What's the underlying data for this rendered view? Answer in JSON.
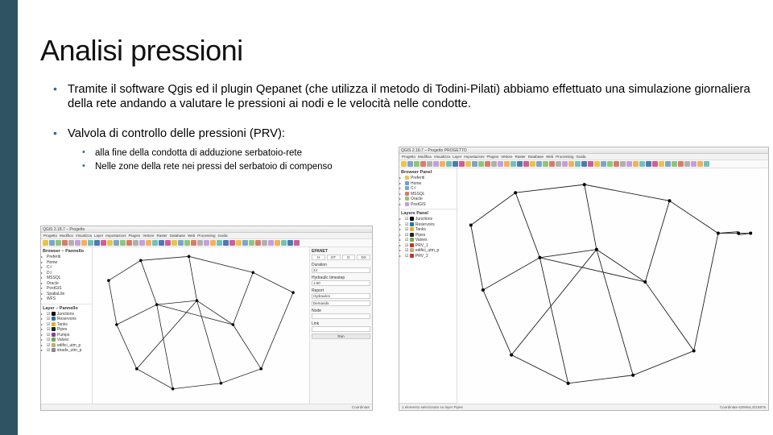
{
  "slide": {
    "title_a": "Analisi",
    "title_b": " pressioni",
    "bullet1": "Tramite il software Qgis ed il plugin Qepanet (che utilizza il metodo di Todini-Pilati) abbiamo effettuato una simulazione giornaliera della rete andando a valutare le pressioni ai nodi e le velocità nelle condotte.",
    "bullet2": "Valvola di controllo delle pressioni (PRV):",
    "sub1": "alla fine della condotta di adduzione serbatoio-rete",
    "sub2": "Nelle zone della rete nei pressi del serbatoio di compenso"
  },
  "shotL": {
    "title": "QGIS 2.18.7 – Progetto",
    "menus": [
      "Progetto",
      "Modifica",
      "Visualizza",
      "Layer",
      "Impostazioni",
      "Plugins",
      "Vettore",
      "Raster",
      "Database",
      "Web",
      "Processing",
      "Guida"
    ],
    "browser_hd": "Browser – Pannello",
    "browser_items": [
      "Preferiti",
      "Home",
      "C:/",
      "D:/",
      "MSSQL",
      "Oracle",
      "PostGIS",
      "SpatiaLite",
      "WFS"
    ],
    "layers_hd": "Layer – Pannello",
    "layers": [
      {
        "name": "Junctions",
        "color": "#000000"
      },
      {
        "name": "Reservoirs",
        "color": "#2b6fb3"
      },
      {
        "name": "Tanks",
        "color": "#e0b030"
      },
      {
        "name": "Pipes",
        "color": "#222222"
      },
      {
        "name": "Pumps",
        "color": "#8b3fa0"
      },
      {
        "name": "Valves",
        "color": "#6fae4c"
      },
      {
        "name": "edifici_utm_p",
        "color": "#c9a87a"
      },
      {
        "name": "strade_utm_p",
        "color": "#888888"
      }
    ],
    "right_hd": "EPANET",
    "tabs": [
      "H",
      "DT",
      "D",
      "DS"
    ],
    "duration_lbl": "Duration",
    "duration_val": "24",
    "hydts_lbl": "Hydraulic timestep",
    "hydts_val": "1:00",
    "report_lbl": "Report",
    "hyd_lbl": "Hydraulics",
    "dem_lbl": "Demands",
    "node_lbl": "Node",
    "link_lbl": "Link",
    "run_lbl": "Run",
    "status": "Coordinate"
  },
  "shotR": {
    "title": "QGIS 2.18.7 – Progetto PROGETTO",
    "menus": [
      "Progetto",
      "Modifica",
      "Visualizza",
      "Layer",
      "Impostazioni",
      "Plugins",
      "Vettore",
      "Raster",
      "Database",
      "Web",
      "Processing",
      "Guida"
    ],
    "browser_hd": "Browser Panel",
    "browser_items": [
      {
        "name": "Preferiti",
        "color": "#e9c34b"
      },
      {
        "name": "Home",
        "color": "#6aa0d8"
      },
      {
        "name": "C:/",
        "color": "#7aa6c9"
      },
      {
        "name": "MSSQL",
        "color": "#d87c6a"
      },
      {
        "name": "Oracle",
        "color": "#8fc57a"
      },
      {
        "name": "PostGIS",
        "color": "#c49fd8"
      }
    ],
    "layers_hd": "Layers Panel",
    "layers": [
      {
        "name": "Junctions",
        "color": "#000000"
      },
      {
        "name": "Reservoirs",
        "color": "#2b6fb3"
      },
      {
        "name": "Tanks",
        "color": "#e0b030"
      },
      {
        "name": "Pipes",
        "color": "#222222"
      },
      {
        "name": "Valves",
        "color": "#6fae4c"
      },
      {
        "name": "PRV_1",
        "color": "#c0342b"
      },
      {
        "name": "edifici_utm_p",
        "color": "#c9a87a"
      },
      {
        "name": "PRV_2",
        "color": "#c0342b"
      }
    ],
    "status_left": "1 elemento selezionato su layer Pipes",
    "status_right": "Coordinate    629464,4216876"
  }
}
